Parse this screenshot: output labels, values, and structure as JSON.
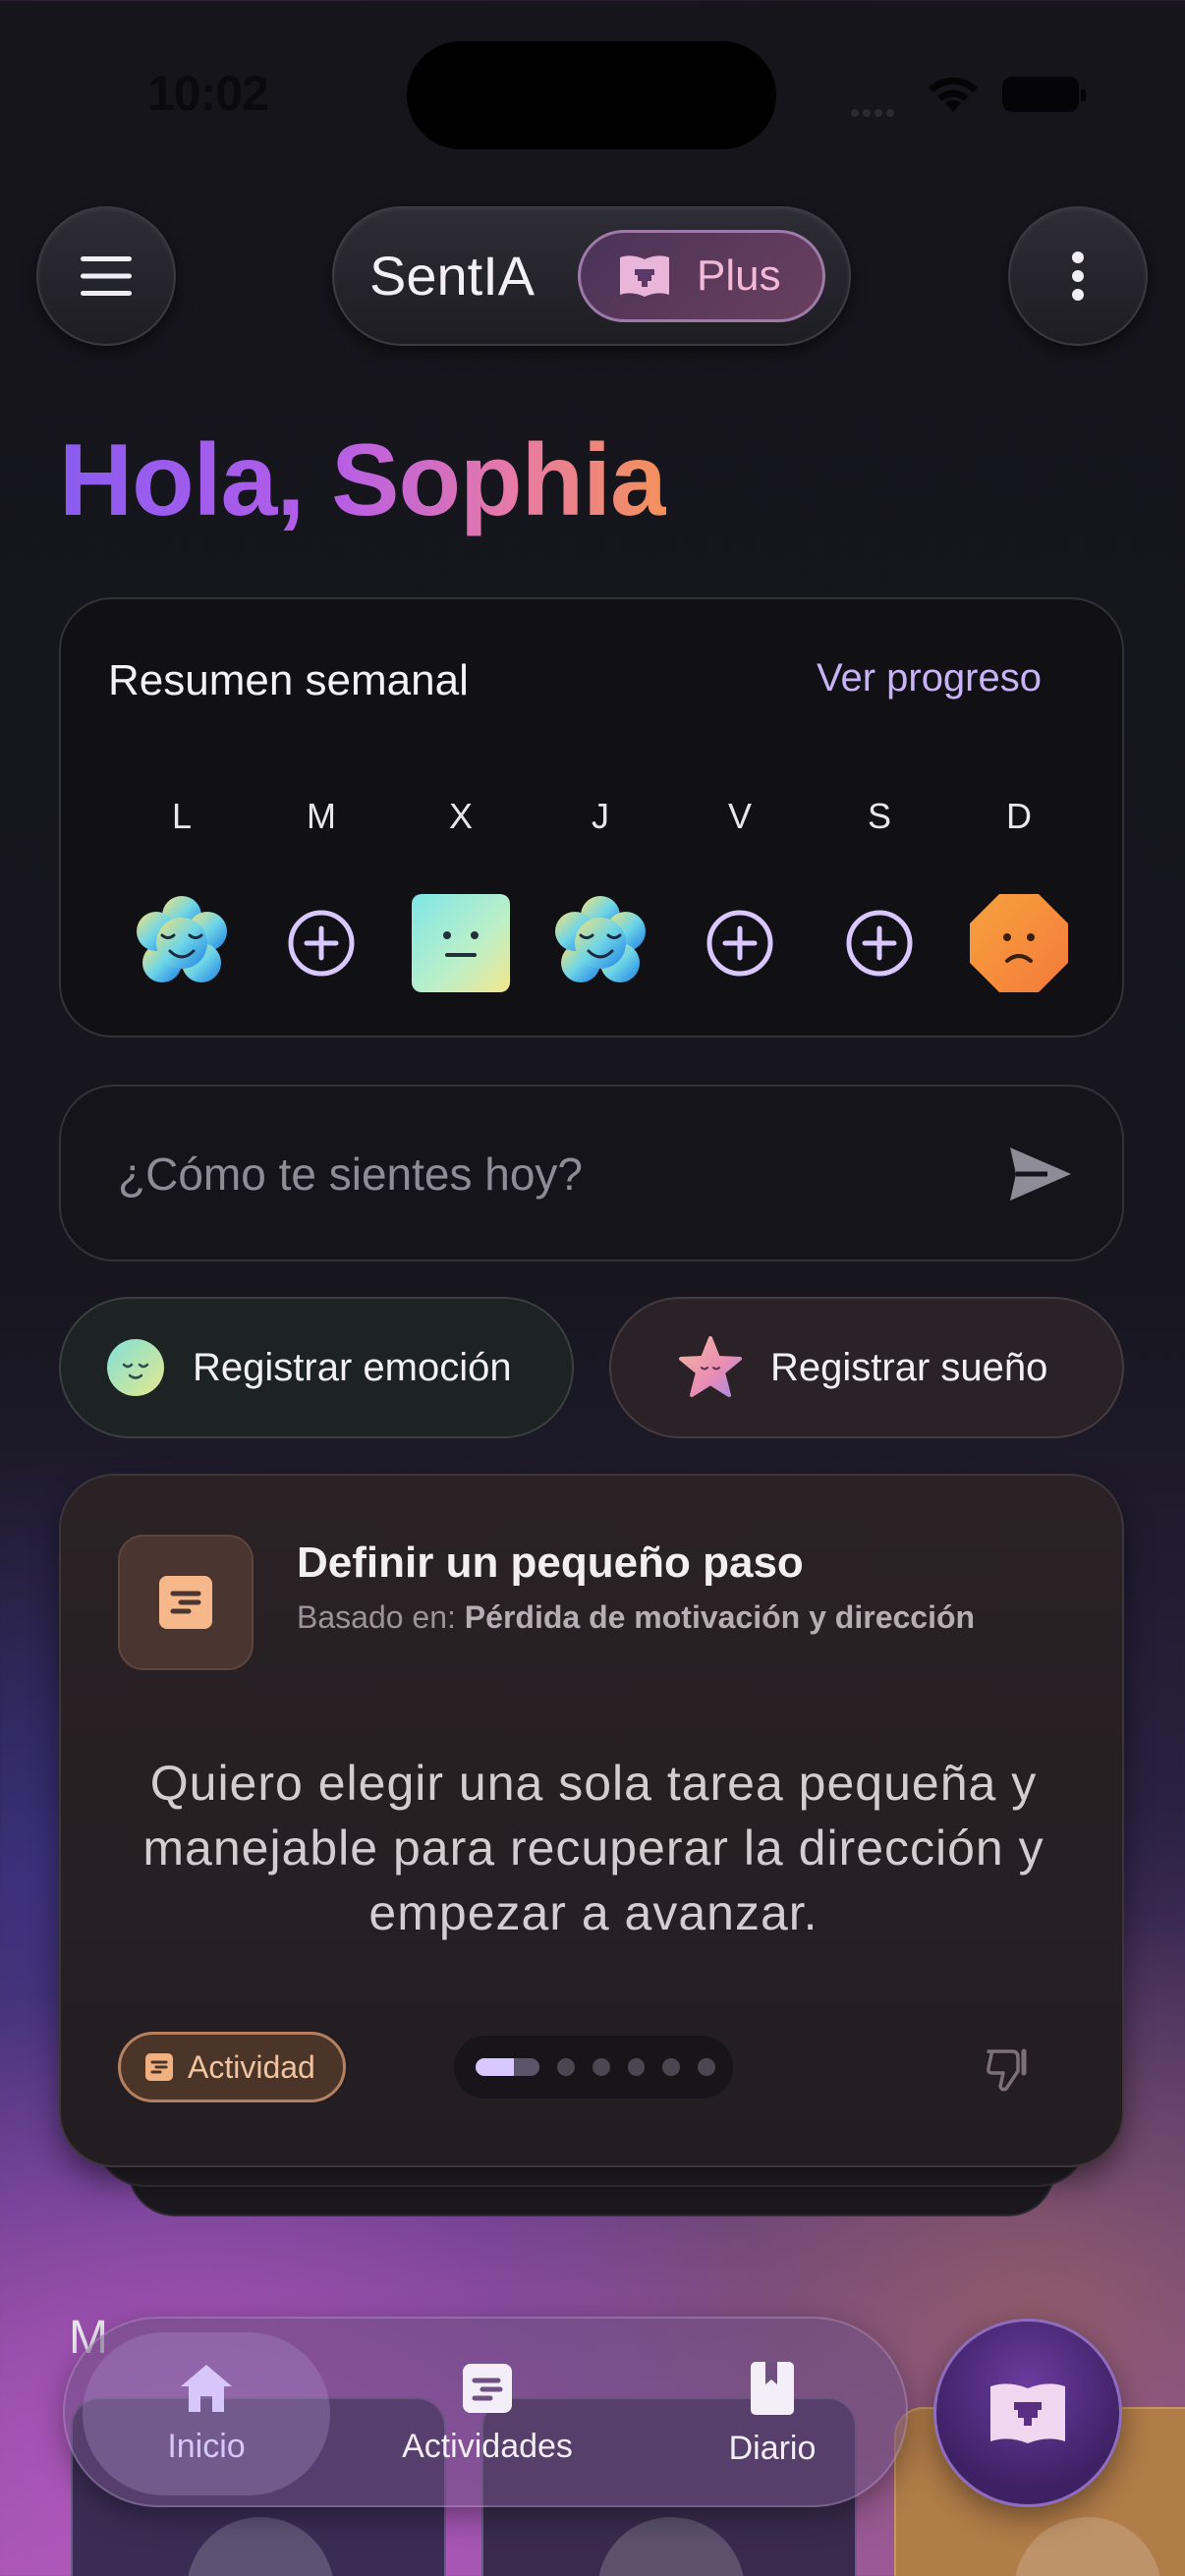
{
  "status_bar": {
    "time": "10:02"
  },
  "header": {
    "app_name": "SentIA",
    "plan_label": "Plus"
  },
  "greeting": "Hola, Sophia",
  "weekly_summary": {
    "title": "Resumen semanal",
    "link": "Ver progreso",
    "days": [
      {
        "letter": "L",
        "state": "calm-flower"
      },
      {
        "letter": "M",
        "state": "add"
      },
      {
        "letter": "X",
        "state": "neutral-square"
      },
      {
        "letter": "J",
        "state": "calm-flower"
      },
      {
        "letter": "V",
        "state": "add"
      },
      {
        "letter": "S",
        "state": "add"
      },
      {
        "letter": "D",
        "state": "sad-octagon"
      }
    ]
  },
  "mood_input": {
    "placeholder": "¿Cómo te sientes hoy?"
  },
  "quick_actions": {
    "emotion": "Registrar emoción",
    "sleep": "Registrar sueño"
  },
  "suggestion": {
    "title": "Definir un pequeño paso",
    "basis_prefix": "Basado en:",
    "basis_value": "Pérdida de motivación y dirección",
    "body": "Quiero elegir una sola tarea pequeña y manejable para recuperar la dirección y empezar a avanzar.",
    "tag": "Actividad",
    "pager": {
      "current": 1,
      "total": 6
    }
  },
  "section_peek": "M",
  "tabbar": {
    "home": "Inicio",
    "activities": "Actividades",
    "diary": "Diario"
  },
  "colors": {
    "accent_purple": "#C9B3F7",
    "greeting_gradient": [
      "#8A5CF0",
      "#B65DE8",
      "#E77AA6",
      "#F4915A"
    ],
    "activity_orange": "#F0C4A0"
  }
}
